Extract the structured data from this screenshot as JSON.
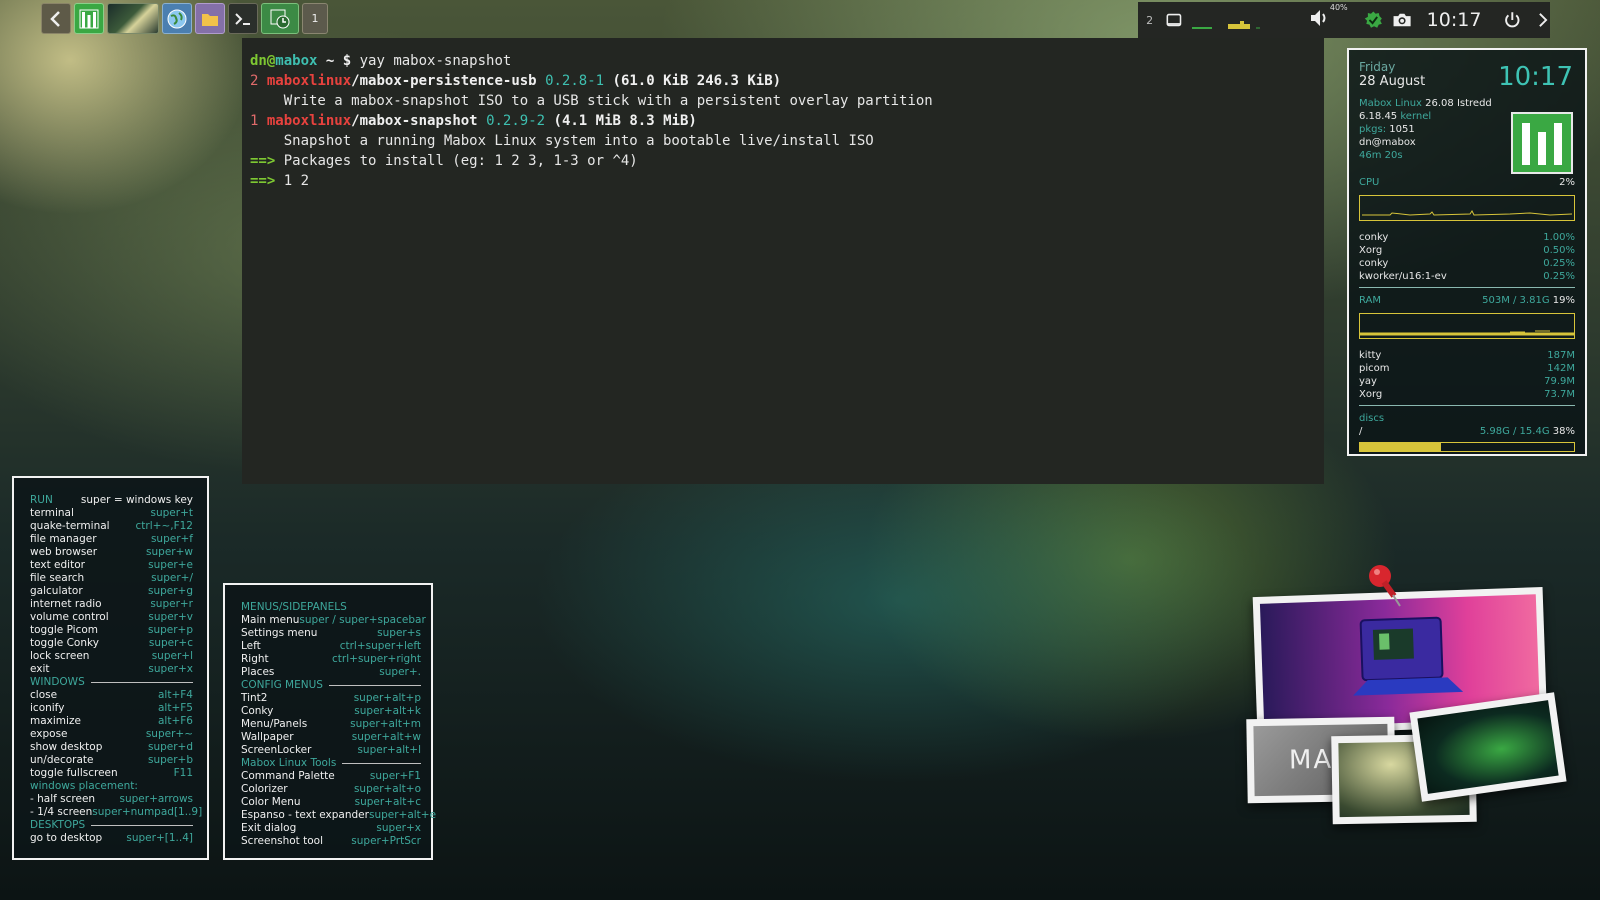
{
  "launcher": {
    "workspace_button": "1"
  },
  "tray": {
    "desktop_number": "2",
    "volume_percent": "40%",
    "clock": "10:17"
  },
  "terminal": {
    "prompt_user": "dn",
    "prompt_at": "@",
    "prompt_host": "mabox",
    "prompt_path": " ~ $ ",
    "command": "yay mabox-snapshot",
    "results": [
      {
        "num": "2",
        "repo": "maboxlinux",
        "slash": "/",
        "pkg": "mabox-persistence-usb",
        "version": "0.2.8-1",
        "size": "(61.0 KiB 246.3 KiB)",
        "desc": "    Write a mabox-snapshot ISO to a USB stick with a persistent overlay partition"
      },
      {
        "num": "1",
        "repo": "maboxlinux",
        "slash": "/",
        "pkg": "mabox-snapshot",
        "version": "0.2.9-2",
        "size": "(4.1 MiB 8.3 MiB)",
        "desc": "    Snapshot a running Mabox Linux system into a bootable live/install ISO"
      }
    ],
    "arrow": "==>",
    "prompt_line": " Packages to install (eg: 1 2 3, 1-3 or ^4)",
    "answer_line": " 1 2"
  },
  "sysinfo": {
    "day": "Friday",
    "date": "28 August",
    "time": "10:17",
    "distro_label": "Mabox Linux",
    "distro_version": "26.08 Istredd",
    "kernel_version": "6.18.45",
    "kernel_label": "kernel",
    "pkgs_label": "pkgs:",
    "pkgs_value": "1051",
    "user": "dn@mabox",
    "uptime": "46m 20s",
    "cpu_label": "CPU",
    "cpu_value": "2%",
    "cpu_procs": [
      {
        "name": "conky",
        "value": "1.00%"
      },
      {
        "name": "Xorg",
        "value": "0.50%"
      },
      {
        "name": "conky",
        "value": "0.25%"
      },
      {
        "name": "kworker/u16:1-ev",
        "value": "0.25%"
      }
    ],
    "ram_label": "RAM",
    "ram_used": "503M / 3.81G",
    "ram_percent": "19%",
    "ram_procs": [
      {
        "name": "kitty",
        "value": "187M"
      },
      {
        "name": "picom",
        "value": "142M"
      },
      {
        "name": "yay",
        "value": "79.9M"
      },
      {
        "name": "Xorg",
        "value": "73.7M"
      }
    ],
    "discs_label": "discs",
    "disc_mount": "/",
    "disc_used": "5.98G / 15.4G",
    "disc_percent": "38%",
    "disc_fill_fraction": 0.38,
    "ram_fill_fraction": 0.03,
    "colors": {
      "accent": "#3ea89c",
      "bar": "#d7c43a",
      "logo": "#3aa843"
    }
  },
  "keybinds_left": {
    "run_title": "RUN",
    "run_note": "super = windows key",
    "run": [
      {
        "k": "terminal",
        "v": "super+t"
      },
      {
        "k": "quake-terminal",
        "v": "ctrl+~,F12"
      },
      {
        "k": "file manager",
        "v": "super+f"
      },
      {
        "k": "web browser",
        "v": "super+w"
      },
      {
        "k": "text editor",
        "v": "super+e"
      },
      {
        "k": "file search",
        "v": "super+/"
      },
      {
        "k": "galculator",
        "v": "super+g"
      },
      {
        "k": "internet radio",
        "v": "super+r"
      },
      {
        "k": "volume control",
        "v": "super+v"
      },
      {
        "k": "toggle Picom",
        "v": "super+p"
      },
      {
        "k": "toggle Conky",
        "v": "super+c"
      },
      {
        "k": "lock screen",
        "v": "super+l"
      },
      {
        "k": "exit",
        "v": "super+x"
      }
    ],
    "windows_title": "WINDOWS",
    "windows": [
      {
        "k": "close",
        "v": "alt+F4"
      },
      {
        "k": "iconify",
        "v": "alt+F5"
      },
      {
        "k": "maximize",
        "v": "alt+F6"
      },
      {
        "k": "expose",
        "v": "super+~"
      },
      {
        "k": "show desktop",
        "v": "super+d"
      },
      {
        "k": "un/decorate",
        "v": "super+b"
      },
      {
        "k": "toggle fullscreen",
        "v": "F11"
      }
    ],
    "placement_title": "windows placement:",
    "placement": [
      {
        "k": " - half screen",
        "v": "super+arrows"
      },
      {
        "k": " - 1/4 screen",
        "v": "super+numpad[1..9]"
      }
    ],
    "desktops_title": "DESKTOPS",
    "desktops": [
      {
        "k": "go to desktop",
        "v": "super+[1..4]"
      }
    ]
  },
  "keybinds_right": {
    "menus_title": "MENUS/SIDEPANELS",
    "menus": [
      {
        "k": "Main menu",
        "v": "super / super+spacebar"
      },
      {
        "k": "Settings menu",
        "v": "super+s"
      },
      {
        "k": "Left",
        "v": "ctrl+super+left"
      },
      {
        "k": "Right",
        "v": "ctrl+super+right"
      },
      {
        "k": "Places",
        "v": "super+."
      }
    ],
    "config_title": "CONFIG MENUS",
    "config": [
      {
        "k": "Tint2",
        "v": "super+alt+p"
      },
      {
        "k": "Conky",
        "v": "super+alt+k"
      },
      {
        "k": "Menu/Panels",
        "v": "super+alt+m"
      },
      {
        "k": "Wallpaper",
        "v": "super+alt+w"
      },
      {
        "k": "ScreenLocker",
        "v": "super+alt+l"
      }
    ],
    "tools_title": "Mabox Linux Tools",
    "tools": [
      {
        "k": "Command Palette",
        "v": "super+F1"
      },
      {
        "k": "Colorizer",
        "v": "super+alt+o"
      },
      {
        "k": "Color Menu",
        "v": "super+alt+c"
      },
      {
        "k": "Espanso - text expander",
        "v": "super+alt+e"
      },
      {
        "k": "Exit dialog",
        "v": "super+x"
      },
      {
        "k": "Screenshot tool",
        "v": "super+PrtScr"
      }
    ]
  },
  "collage": {
    "logo_text": "MAB"
  }
}
